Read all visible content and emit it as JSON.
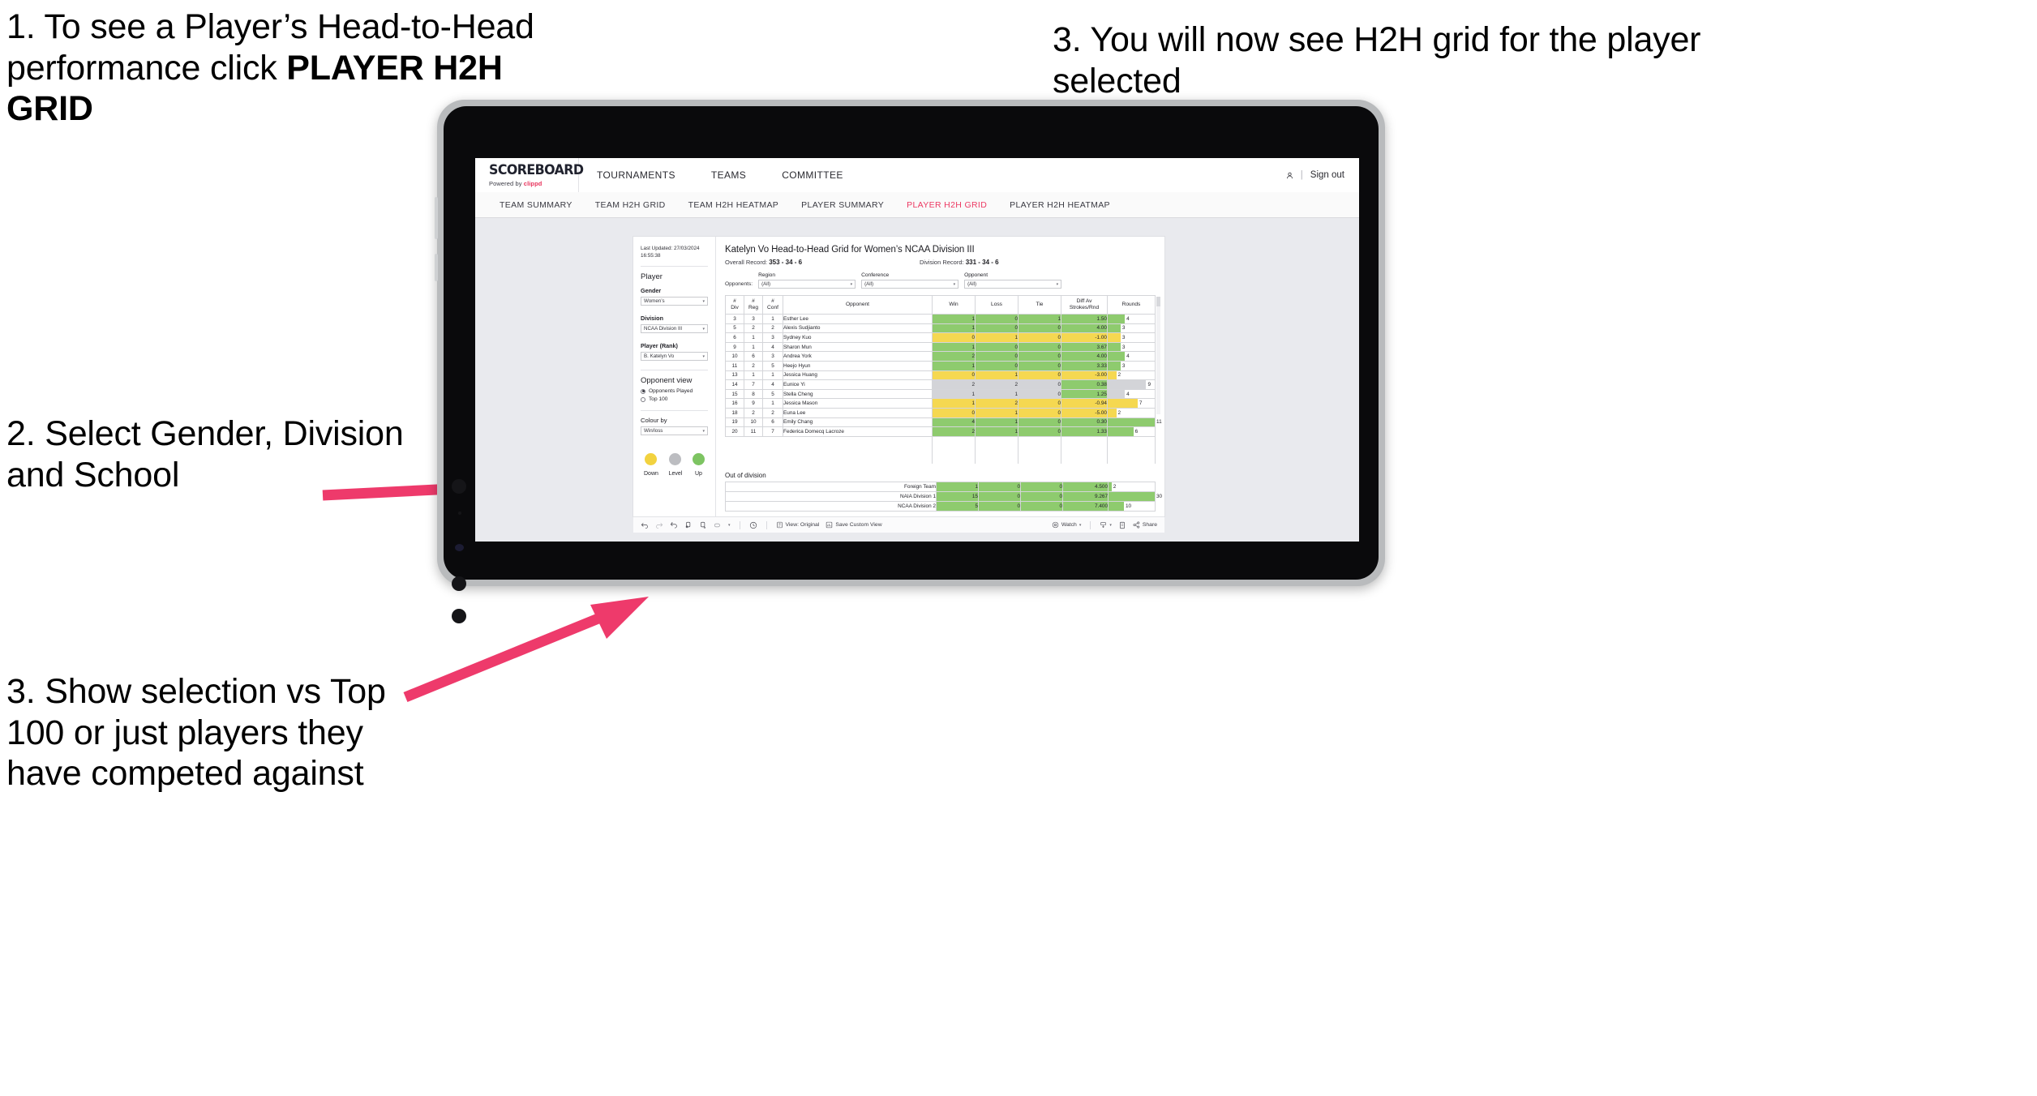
{
  "annotations": [
    {
      "id": "annot-1",
      "line1": "1. To see a Player’s Head-to-Head performance click ",
      "bold": "PLAYER H2H GRID"
    },
    {
      "id": "annot-2",
      "text": "2. Select Gender, Division and School"
    },
    {
      "id": "annot-3",
      "text": "3. Show selection vs Top 100 or just players they have competed against"
    },
    {
      "id": "annot-4",
      "text": "3. You will now see H2H grid for the player selected"
    }
  ],
  "accent_color": "#ec3a63",
  "arrow_color": "#ee3a6b",
  "app": {
    "brand": {
      "title": "SCOREBOARD",
      "powered_prefix": "Powered by ",
      "powered_brand": "clippd"
    },
    "topnav": [
      {
        "label": "TOURNAMENTS"
      },
      {
        "label": "TEAMS"
      },
      {
        "label": "COMMITTEE"
      }
    ],
    "header_right": {
      "account_icon": "person-icon",
      "separator": "|",
      "sign_out": "Sign out"
    },
    "subnav": [
      {
        "label": "TEAM SUMMARY",
        "active": false
      },
      {
        "label": "TEAM H2H GRID",
        "active": false
      },
      {
        "label": "TEAM H2H HEATMAP",
        "active": false
      },
      {
        "label": "PLAYER SUMMARY",
        "active": false
      },
      {
        "label": "PLAYER H2H GRID",
        "active": true
      },
      {
        "label": "PLAYER H2H HEATMAP",
        "active": false
      }
    ]
  },
  "filters": {
    "last_updated": "Last Updated: 27/03/2024 16:55:38",
    "player_heading": "Player",
    "gender": {
      "label": "Gender",
      "value": "Women’s"
    },
    "division": {
      "label": "Division",
      "value": "NCAA Division III"
    },
    "player_rank": {
      "label": "Player (Rank)",
      "value": "B. Katelyn Vo"
    },
    "opponent_view": {
      "heading": "Opponent view",
      "options": [
        {
          "label": "Opponents Played",
          "selected": true
        },
        {
          "label": "Top 100",
          "selected": false
        }
      ]
    },
    "colour_by": {
      "label": "Colour by",
      "value": "Win/loss"
    },
    "legend": [
      {
        "label": "Down",
        "color": "#f2d23f"
      },
      {
        "label": "Level",
        "color": "#bcbdc1"
      },
      {
        "label": "Up",
        "color": "#7dc462"
      }
    ]
  },
  "viz": {
    "title": "Katelyn Vo Head-to-Head Grid for Women’s NCAA Division III",
    "overall_record_label": "Overall Record: ",
    "overall_record_value": "353 - 34 - 6",
    "division_record_label": "Division Record: ",
    "division_record_value": "331 - 34 - 6",
    "opponents_label": "Opponents:",
    "opponent_filters": [
      {
        "label": "Region",
        "value": "(All)"
      },
      {
        "label": "Conference",
        "value": "(All)"
      },
      {
        "label": "Opponent",
        "value": "(All)"
      }
    ],
    "columns": [
      "# Div",
      "# Reg",
      "# Conf",
      "Opponent",
      "Win",
      "Loss",
      "Tie",
      "Diff Av Strokes/Rnd",
      "Rounds"
    ],
    "column_lines": [
      [
        "#",
        "Div"
      ],
      [
        "#",
        "Reg"
      ],
      [
        "#",
        "Conf"
      ],
      [
        "Opponent"
      ],
      [
        "Win"
      ],
      [
        "Loss"
      ],
      [
        "Tie"
      ],
      [
        "Diff Av",
        "Strokes/Rnd"
      ],
      [
        "Rounds"
      ]
    ],
    "rows": [
      {
        "div": "3",
        "reg": "3",
        "conf": "1",
        "opponent": "Esther Lee",
        "win": "1",
        "loss": "0",
        "tie": "1",
        "diff": "1.50",
        "rounds": "4",
        "state": "up"
      },
      {
        "div": "5",
        "reg": "2",
        "conf": "2",
        "opponent": "Alexis Sudjianto",
        "win": "1",
        "loss": "0",
        "tie": "0",
        "diff": "4.00",
        "rounds": "3",
        "state": "up"
      },
      {
        "div": "6",
        "reg": "1",
        "conf": "3",
        "opponent": "Sydney Kuo",
        "win": "0",
        "loss": "1",
        "tie": "0",
        "diff": "-1.00",
        "rounds": "3",
        "state": "down"
      },
      {
        "div": "9",
        "reg": "1",
        "conf": "4",
        "opponent": "Sharon Mun",
        "win": "1",
        "loss": "0",
        "tie": "0",
        "diff": "3.67",
        "rounds": "3",
        "state": "up"
      },
      {
        "div": "10",
        "reg": "6",
        "conf": "3",
        "opponent": "Andrea York",
        "win": "2",
        "loss": "0",
        "tie": "0",
        "diff": "4.00",
        "rounds": "4",
        "state": "up"
      },
      {
        "div": "11",
        "reg": "2",
        "conf": "5",
        "opponent": "Heejo Hyun",
        "win": "1",
        "loss": "0",
        "tie": "0",
        "diff": "3.33",
        "rounds": "3",
        "state": "up"
      },
      {
        "div": "13",
        "reg": "1",
        "conf": "1",
        "opponent": "Jessica Huang",
        "win": "0",
        "loss": "1",
        "tie": "0",
        "diff": "-3.00",
        "rounds": "2",
        "state": "down"
      },
      {
        "div": "14",
        "reg": "7",
        "conf": "4",
        "opponent": "Eunice Yi",
        "win": "2",
        "loss": "2",
        "tie": "0",
        "diff": "0.38",
        "rounds": "9",
        "state": "level",
        "diff_state": "up"
      },
      {
        "div": "15",
        "reg": "8",
        "conf": "5",
        "opponent": "Stella Cheng",
        "win": "1",
        "loss": "1",
        "tie": "0",
        "diff": "1.25",
        "rounds": "4",
        "state": "level",
        "diff_state": "up"
      },
      {
        "div": "16",
        "reg": "9",
        "conf": "1",
        "opponent": "Jessica Mason",
        "win": "1",
        "loss": "2",
        "tie": "0",
        "diff": "-0.94",
        "rounds": "7",
        "state": "down"
      },
      {
        "div": "18",
        "reg": "2",
        "conf": "2",
        "opponent": "Euna Lee",
        "win": "0",
        "loss": "1",
        "tie": "0",
        "diff": "-5.00",
        "rounds": "2",
        "state": "down"
      },
      {
        "div": "19",
        "reg": "10",
        "conf": "6",
        "opponent": "Emily Chang",
        "win": "4",
        "loss": "1",
        "tie": "0",
        "diff": "0.30",
        "rounds": "11",
        "state": "up"
      },
      {
        "div": "20",
        "reg": "11",
        "conf": "7",
        "opponent": "Federica Domecq Lacroze",
        "win": "2",
        "loss": "1",
        "tie": "0",
        "diff": "1.33",
        "rounds": "6",
        "state": "up"
      }
    ],
    "out_of_division": {
      "title": "Out of division",
      "rows": [
        {
          "name": "Foreign Team",
          "win": "1",
          "loss": "0",
          "tie": "0",
          "diff": "4.500",
          "rounds": "2",
          "state": "up"
        },
        {
          "name": "NAIA Division 1",
          "win": "15",
          "loss": "0",
          "tie": "0",
          "diff": "9.267",
          "rounds": "30",
          "state": "up"
        },
        {
          "name": "NCAA Division 2",
          "win": "5",
          "loss": "0",
          "tie": "0",
          "diff": "7.400",
          "rounds": "10",
          "state": "up"
        }
      ]
    }
  },
  "toolbar": {
    "icons": [
      "undo-icon",
      "redo-icon",
      "revert-icon",
      "refresh-icon",
      "pause-icon",
      "resize-icon",
      "chevron-down-icon",
      "clock-icon"
    ],
    "view_label": "View: Original",
    "save_label": "Save Custom View",
    "watch_label": "Watch",
    "download_icon": "download-icon",
    "fullscreen_icon": "fullscreen-icon",
    "share_label": "Share"
  }
}
